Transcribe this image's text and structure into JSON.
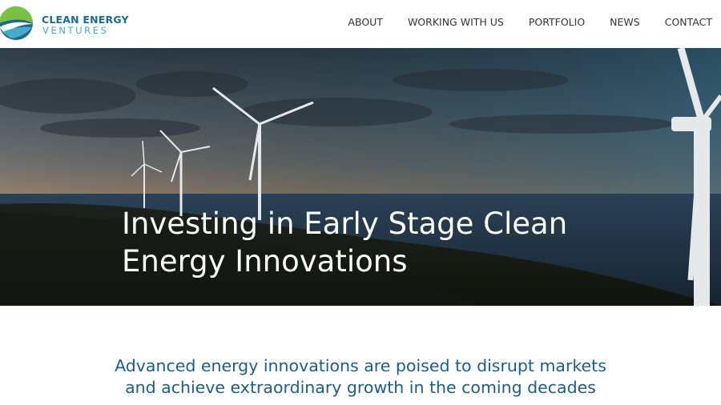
{
  "brand": {
    "line1": "CLEAN ENERGY",
    "line2": "VENTURES",
    "colors": {
      "primary": "#1b6b8f",
      "accent": "#4ba9c9",
      "green": "#7ac143"
    }
  },
  "nav": {
    "items": [
      {
        "label": "ABOUT"
      },
      {
        "label": "WORKING WITH US"
      },
      {
        "label": "PORTFOLIO"
      },
      {
        "label": "NEWS"
      },
      {
        "label": "CONTACT"
      }
    ]
  },
  "hero": {
    "title": "Investing in Early Stage Clean Energy Innovations",
    "image": "wind-turbines-coastline-photo"
  },
  "intro": {
    "line1": "Advanced energy innovations are poised to disrupt markets",
    "line2": "and achieve extraordinary growth in the coming decades",
    "color": "#1e5d85"
  }
}
